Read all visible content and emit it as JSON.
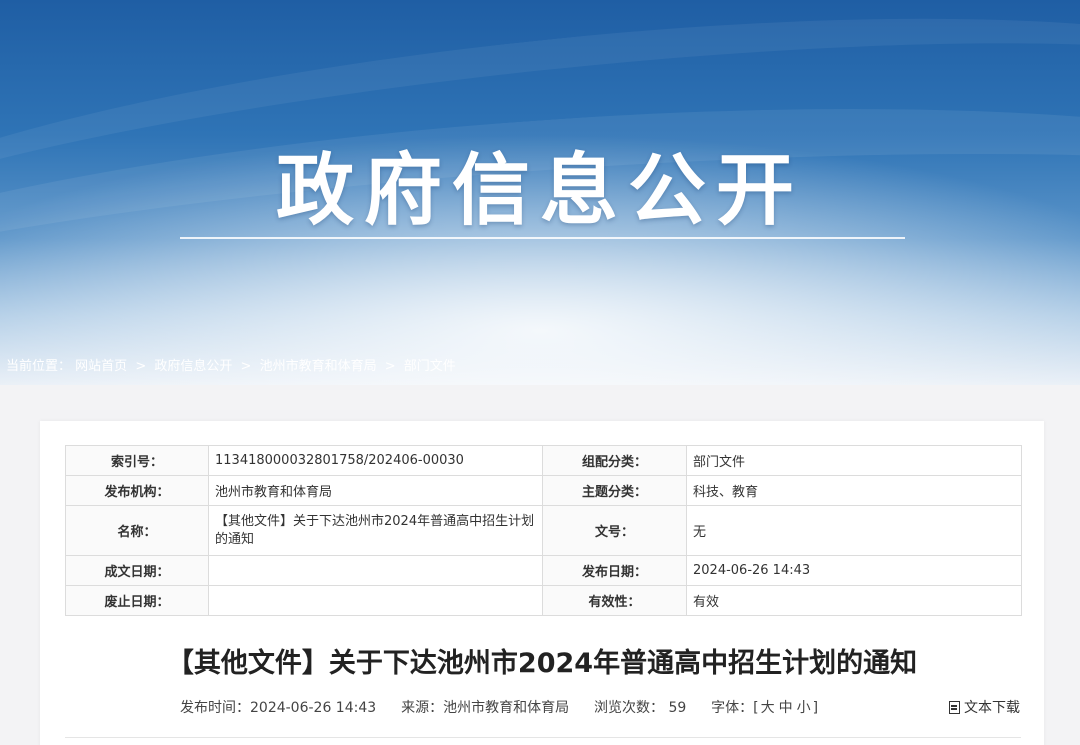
{
  "banner": {
    "title": "政府信息公开"
  },
  "breadcrumb": {
    "prefix": "当前位置：",
    "items": [
      "网站首页",
      "政府信息公开",
      "池州市教育和体育局",
      "部门文件"
    ],
    "separator": ">"
  },
  "meta": {
    "index_label": "索引号：",
    "index_value": "113418000032801758/202406-00030",
    "category_label": "组配分类：",
    "category_value": "部门文件",
    "publisher_label": "发布机构：",
    "publisher_value": "池州市教育和体育局",
    "topic_label": "主题分类：",
    "topic_value": "科技、教育",
    "name_label": "名称：",
    "name_value": "【其他文件】关于下达池州市2024年普通高中招生计划的通知",
    "docno_label": "文号：",
    "docno_value": "无",
    "created_label": "成文日期：",
    "created_value": "",
    "published_label": "发布日期：",
    "published_value": "2024-06-26 14:43",
    "abolished_label": "废止日期：",
    "abolished_value": "",
    "validity_label": "有效性：",
    "validity_value": "有效"
  },
  "article": {
    "title": "【其他文件】关于下达池州市2024年普通高中招生计划的通知",
    "publish_time_label": "发布时间：",
    "publish_time": "2024-06-26 14:43",
    "source_label": "来源：",
    "source": "池州市教育和体育局",
    "views_label": "浏览次数：",
    "views": "59",
    "font_label": "字体：",
    "font_open": "[",
    "font_large": "大",
    "font_medium": "中",
    "font_small": "小",
    "font_close": "]",
    "download_label": "文本下载",
    "download_icon": "document-icon"
  }
}
